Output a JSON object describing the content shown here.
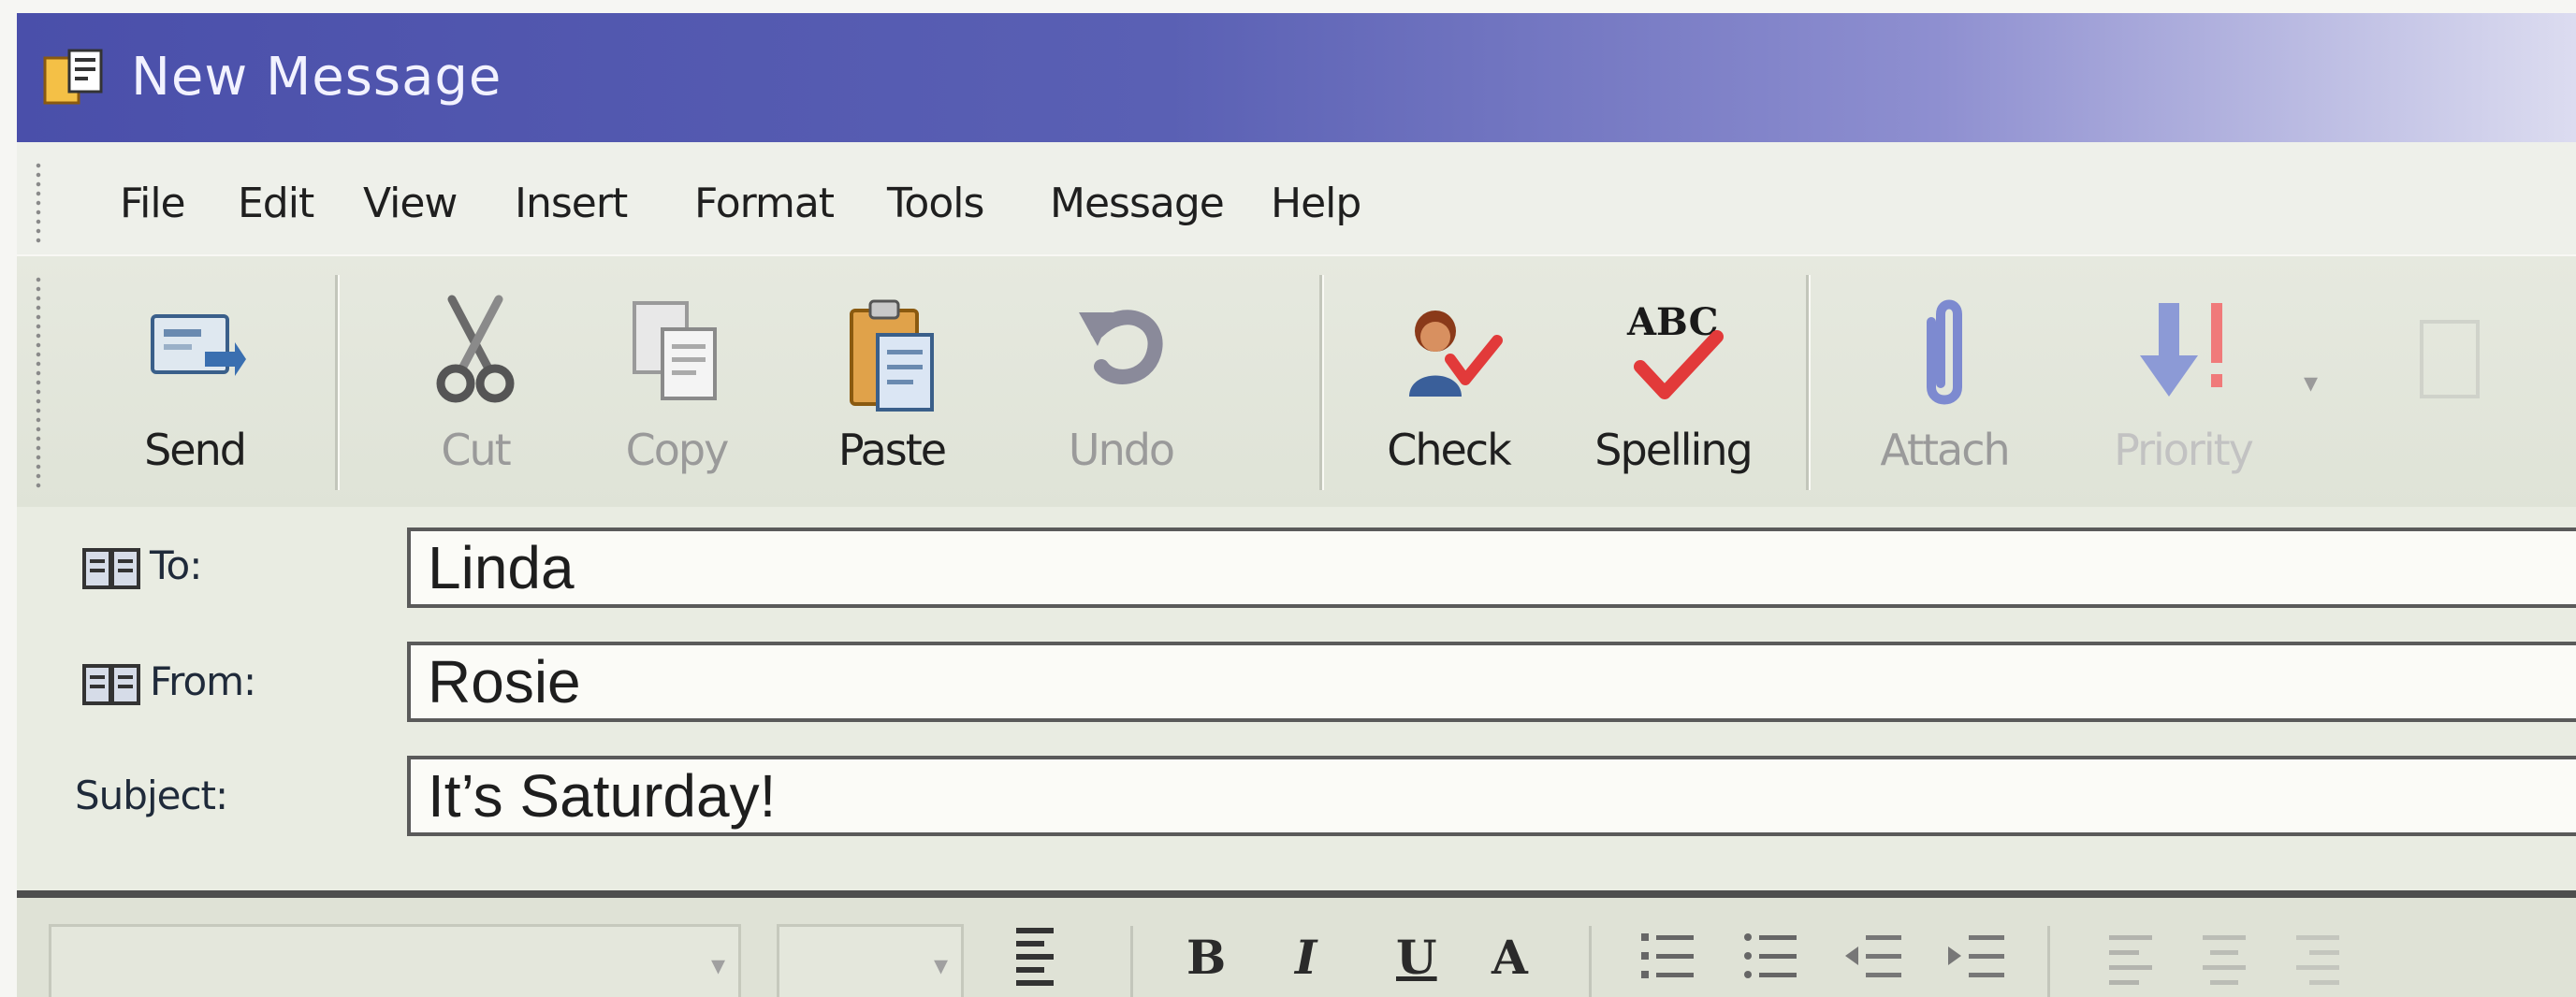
{
  "window": {
    "title": "New Message"
  },
  "menu": [
    "File",
    "Edit",
    "View",
    "Insert",
    "Format",
    "Tools",
    "Message",
    "Help"
  ],
  "toolbar": {
    "buttons": [
      {
        "label": "Send",
        "icon": "send-icon",
        "state": "enabled"
      },
      {
        "label": "Cut",
        "icon": "scissors-icon",
        "state": "disabled"
      },
      {
        "label": "Copy",
        "icon": "copy-icon",
        "state": "disabled"
      },
      {
        "label": "Paste",
        "icon": "paste-icon",
        "state": "enabled"
      },
      {
        "label": "Undo",
        "icon": "undo-icon",
        "state": "disabled"
      },
      {
        "label": "Check",
        "icon": "check-names-icon",
        "state": "enabled"
      },
      {
        "label": "Spelling",
        "icon": "spelling-icon",
        "state": "enabled"
      },
      {
        "label": "Attach",
        "icon": "paperclip-icon",
        "state": "disabled"
      },
      {
        "label": "Priority",
        "icon": "priority-icon",
        "state": "disabled"
      }
    ],
    "spelling_badge": "ABC"
  },
  "fields": {
    "to": {
      "label": "To:",
      "value": "Linda"
    },
    "from": {
      "label": "From:",
      "value": "Rosie"
    },
    "subject": {
      "label": "Subject:",
      "value": "It’s Saturday!"
    }
  },
  "format": {
    "buttons": [
      "B",
      "I",
      "U",
      "A"
    ]
  },
  "colors": {
    "titlebar_start": "#4a4faa",
    "titlebar_end": "#dcdcf0",
    "spell_check": "#e23a3a",
    "attach_blue": "#7d8ad0"
  }
}
